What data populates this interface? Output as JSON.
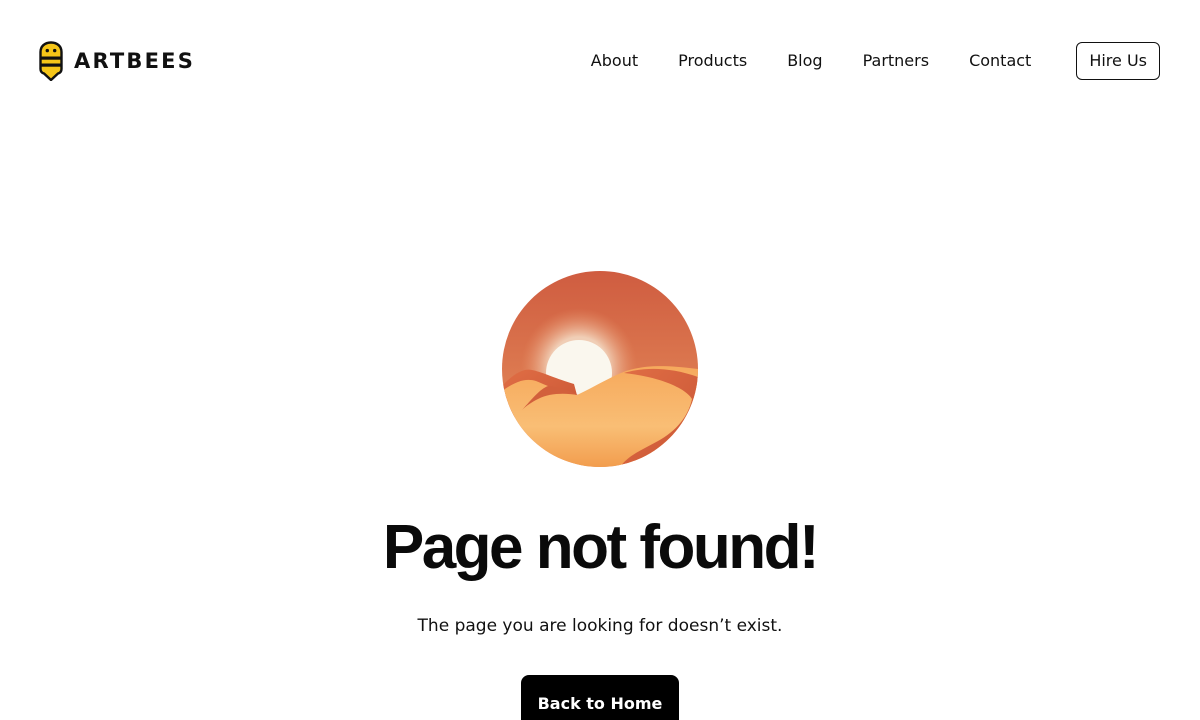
{
  "brand": {
    "name": "ARTBEES",
    "logo_icon": "bee-icon",
    "logo_color": "#F5C518"
  },
  "nav": {
    "items": [
      {
        "label": "About"
      },
      {
        "label": "Products"
      },
      {
        "label": "Blog"
      },
      {
        "label": "Partners"
      },
      {
        "label": "Contact"
      }
    ],
    "cta_label": "Hire Us"
  },
  "main": {
    "illustration_icon": "desert-sunset-icon",
    "title": "Page not found!",
    "message": "The page you are looking for doesn’t exist.",
    "button_label": "Back to Home"
  },
  "colors": {
    "background": "#FFFFFF",
    "text": "#111111",
    "button_bg": "#000000",
    "button_text": "#FFFFFF",
    "sky_top": "#CF5C40",
    "sky_bottom": "#E8935E",
    "sand": "#F7B463",
    "dune_shadow": "#D7653E",
    "sun": "#FAF7EE"
  }
}
